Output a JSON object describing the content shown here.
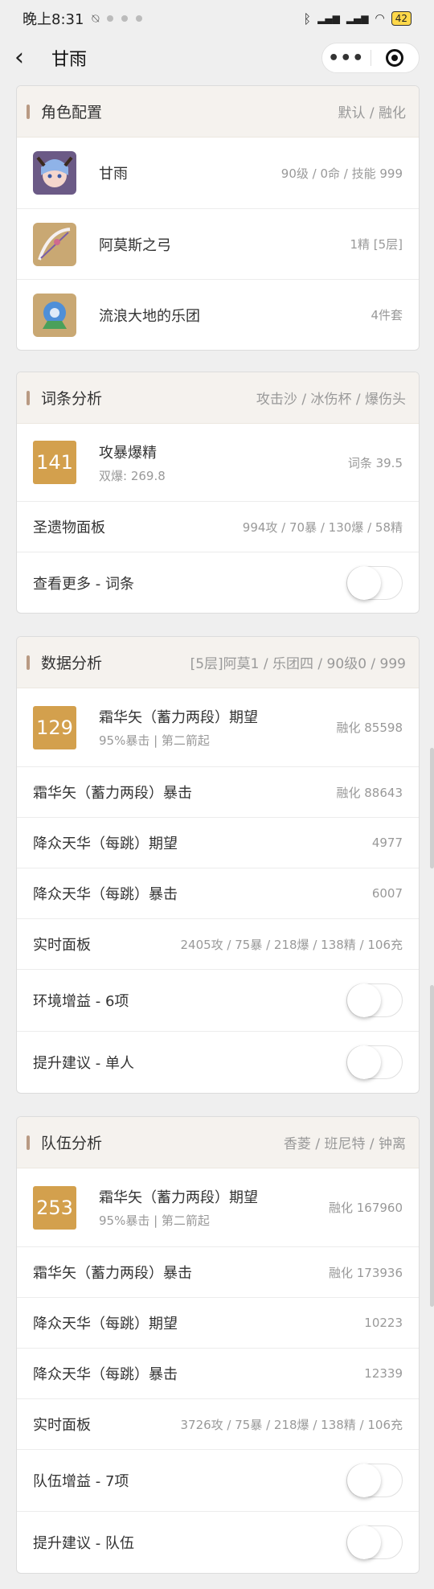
{
  "status_bar": {
    "time": "晚上8:31",
    "battery": "42"
  },
  "nav": {
    "title": "甘雨"
  },
  "role_config": {
    "title": "角色配置",
    "subtitle": "默认 / 融化",
    "items": [
      {
        "name": "甘雨",
        "detail": "90级 / 0命 / 技能 999"
      },
      {
        "name": "阿莫斯之弓",
        "detail": "1精 [5层]"
      },
      {
        "name": "流浪大地的乐团",
        "detail": "4件套"
      }
    ]
  },
  "stat_analysis": {
    "title": "词条分析",
    "subtitle": "攻击沙 / 冰伤杯 / 爆伤头",
    "score": "141",
    "score_title": "攻暴爆精",
    "score_sub": "双爆: 269.8",
    "score_value": "词条 39.5",
    "panel_label": "圣遗物面板",
    "panel_value": "994攻 / 70暴 / 130爆 / 58精",
    "more_label": "查看更多 - 词条"
  },
  "data_analysis": {
    "title": "数据分析",
    "subtitle": "[5层]阿莫1 / 乐团四 / 90级0 / 999",
    "score": "129",
    "score_title": "霜华矢（蓄力两段）期望",
    "score_sub": "95%暴击 | 第二箭起",
    "score_value": "融化 85598",
    "rows": [
      {
        "label": "霜华矢（蓄力两段）暴击",
        "value": "融化 88643"
      },
      {
        "label": "降众天华（每跳）期望",
        "value": "4977"
      },
      {
        "label": "降众天华（每跳）暴击",
        "value": "6007"
      },
      {
        "label": "实时面板",
        "value": "2405攻 / 75暴 / 218爆 / 138精 / 106充"
      }
    ],
    "toggle_1": "环境增益 - 6项",
    "toggle_2": "提升建议 - 单人"
  },
  "team_analysis": {
    "title": "队伍分析",
    "subtitle": "香菱 / 班尼特 / 钟离",
    "score": "253",
    "score_title": "霜华矢（蓄力两段）期望",
    "score_sub": "95%暴击 | 第二箭起",
    "score_value": "融化 167960",
    "rows": [
      {
        "label": "霜华矢（蓄力两段）暴击",
        "value": "融化 173936"
      },
      {
        "label": "降众天华（每跳）期望",
        "value": "10223"
      },
      {
        "label": "降众天华（每跳）暴击",
        "value": "12339"
      },
      {
        "label": "实时面板",
        "value": "3726攻 / 75暴 / 218爆 / 138精 / 106充"
      }
    ],
    "toggle_1": "队伍增益 - 7项",
    "toggle_2": "提升建议 - 队伍"
  },
  "colors": {
    "score_badge": "#d3a04d",
    "header_bg": "#f5f2ee",
    "accent_mark": "#b99a83"
  },
  "icons": [
    "back-arrow-icon",
    "more-dots-icon",
    "close-target-icon",
    "bluetooth-icon",
    "wifi-icon",
    "battery-icon"
  ]
}
